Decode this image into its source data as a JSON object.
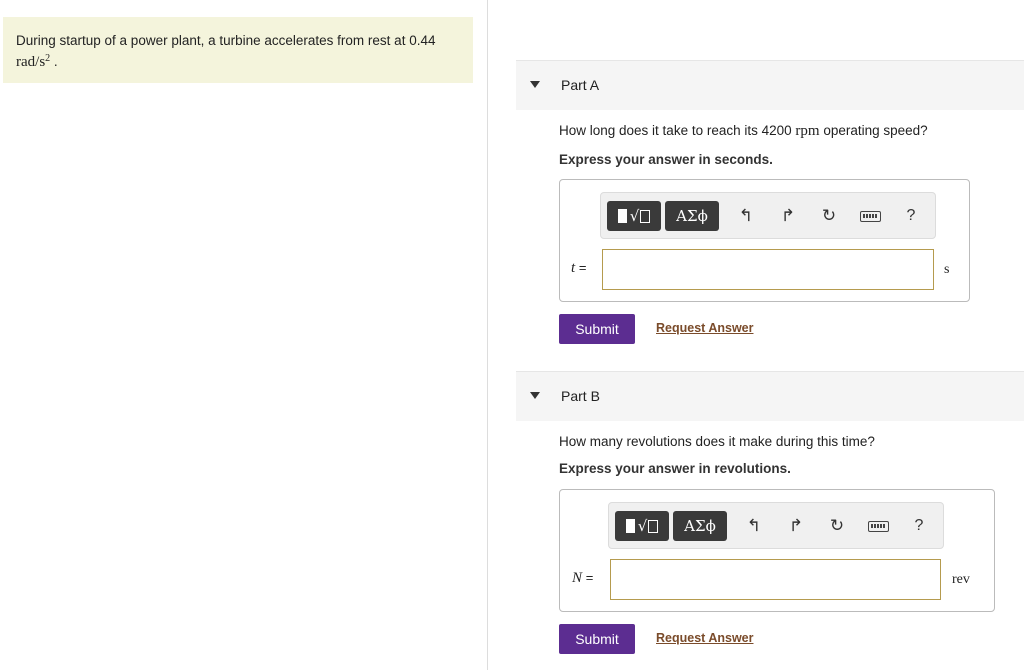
{
  "problem": {
    "text": "During startup of a power plant, a turbine accelerates from rest at 0.44",
    "unit_base": "rad/s",
    "unit_exp": "2",
    "unit_suffix": " ."
  },
  "toolbar": {
    "templates_glyph": "√",
    "greek_label": "ΑΣϕ",
    "undo_glyph": "↰",
    "redo_glyph": "↱",
    "reset_glyph": "↻",
    "help_label": "?"
  },
  "part_a": {
    "title": "Part A",
    "question_before": "How long does it take to reach its 4200 ",
    "question_unit": "rpm",
    "question_after": " operating speed?",
    "instruction": "Express your answer in seconds.",
    "variable": "t",
    "equals": "=",
    "input_value": "",
    "unit": "s",
    "submit_label": "Submit",
    "request_label": "Request Answer"
  },
  "part_b": {
    "title": "Part B",
    "question": "How many revolutions does it make during this time?",
    "instruction": "Express your answer in revolutions.",
    "variable": "N",
    "equals": "=",
    "input_value": "",
    "unit": "rev",
    "submit_label": "Submit",
    "request_label": "Request Answer"
  }
}
